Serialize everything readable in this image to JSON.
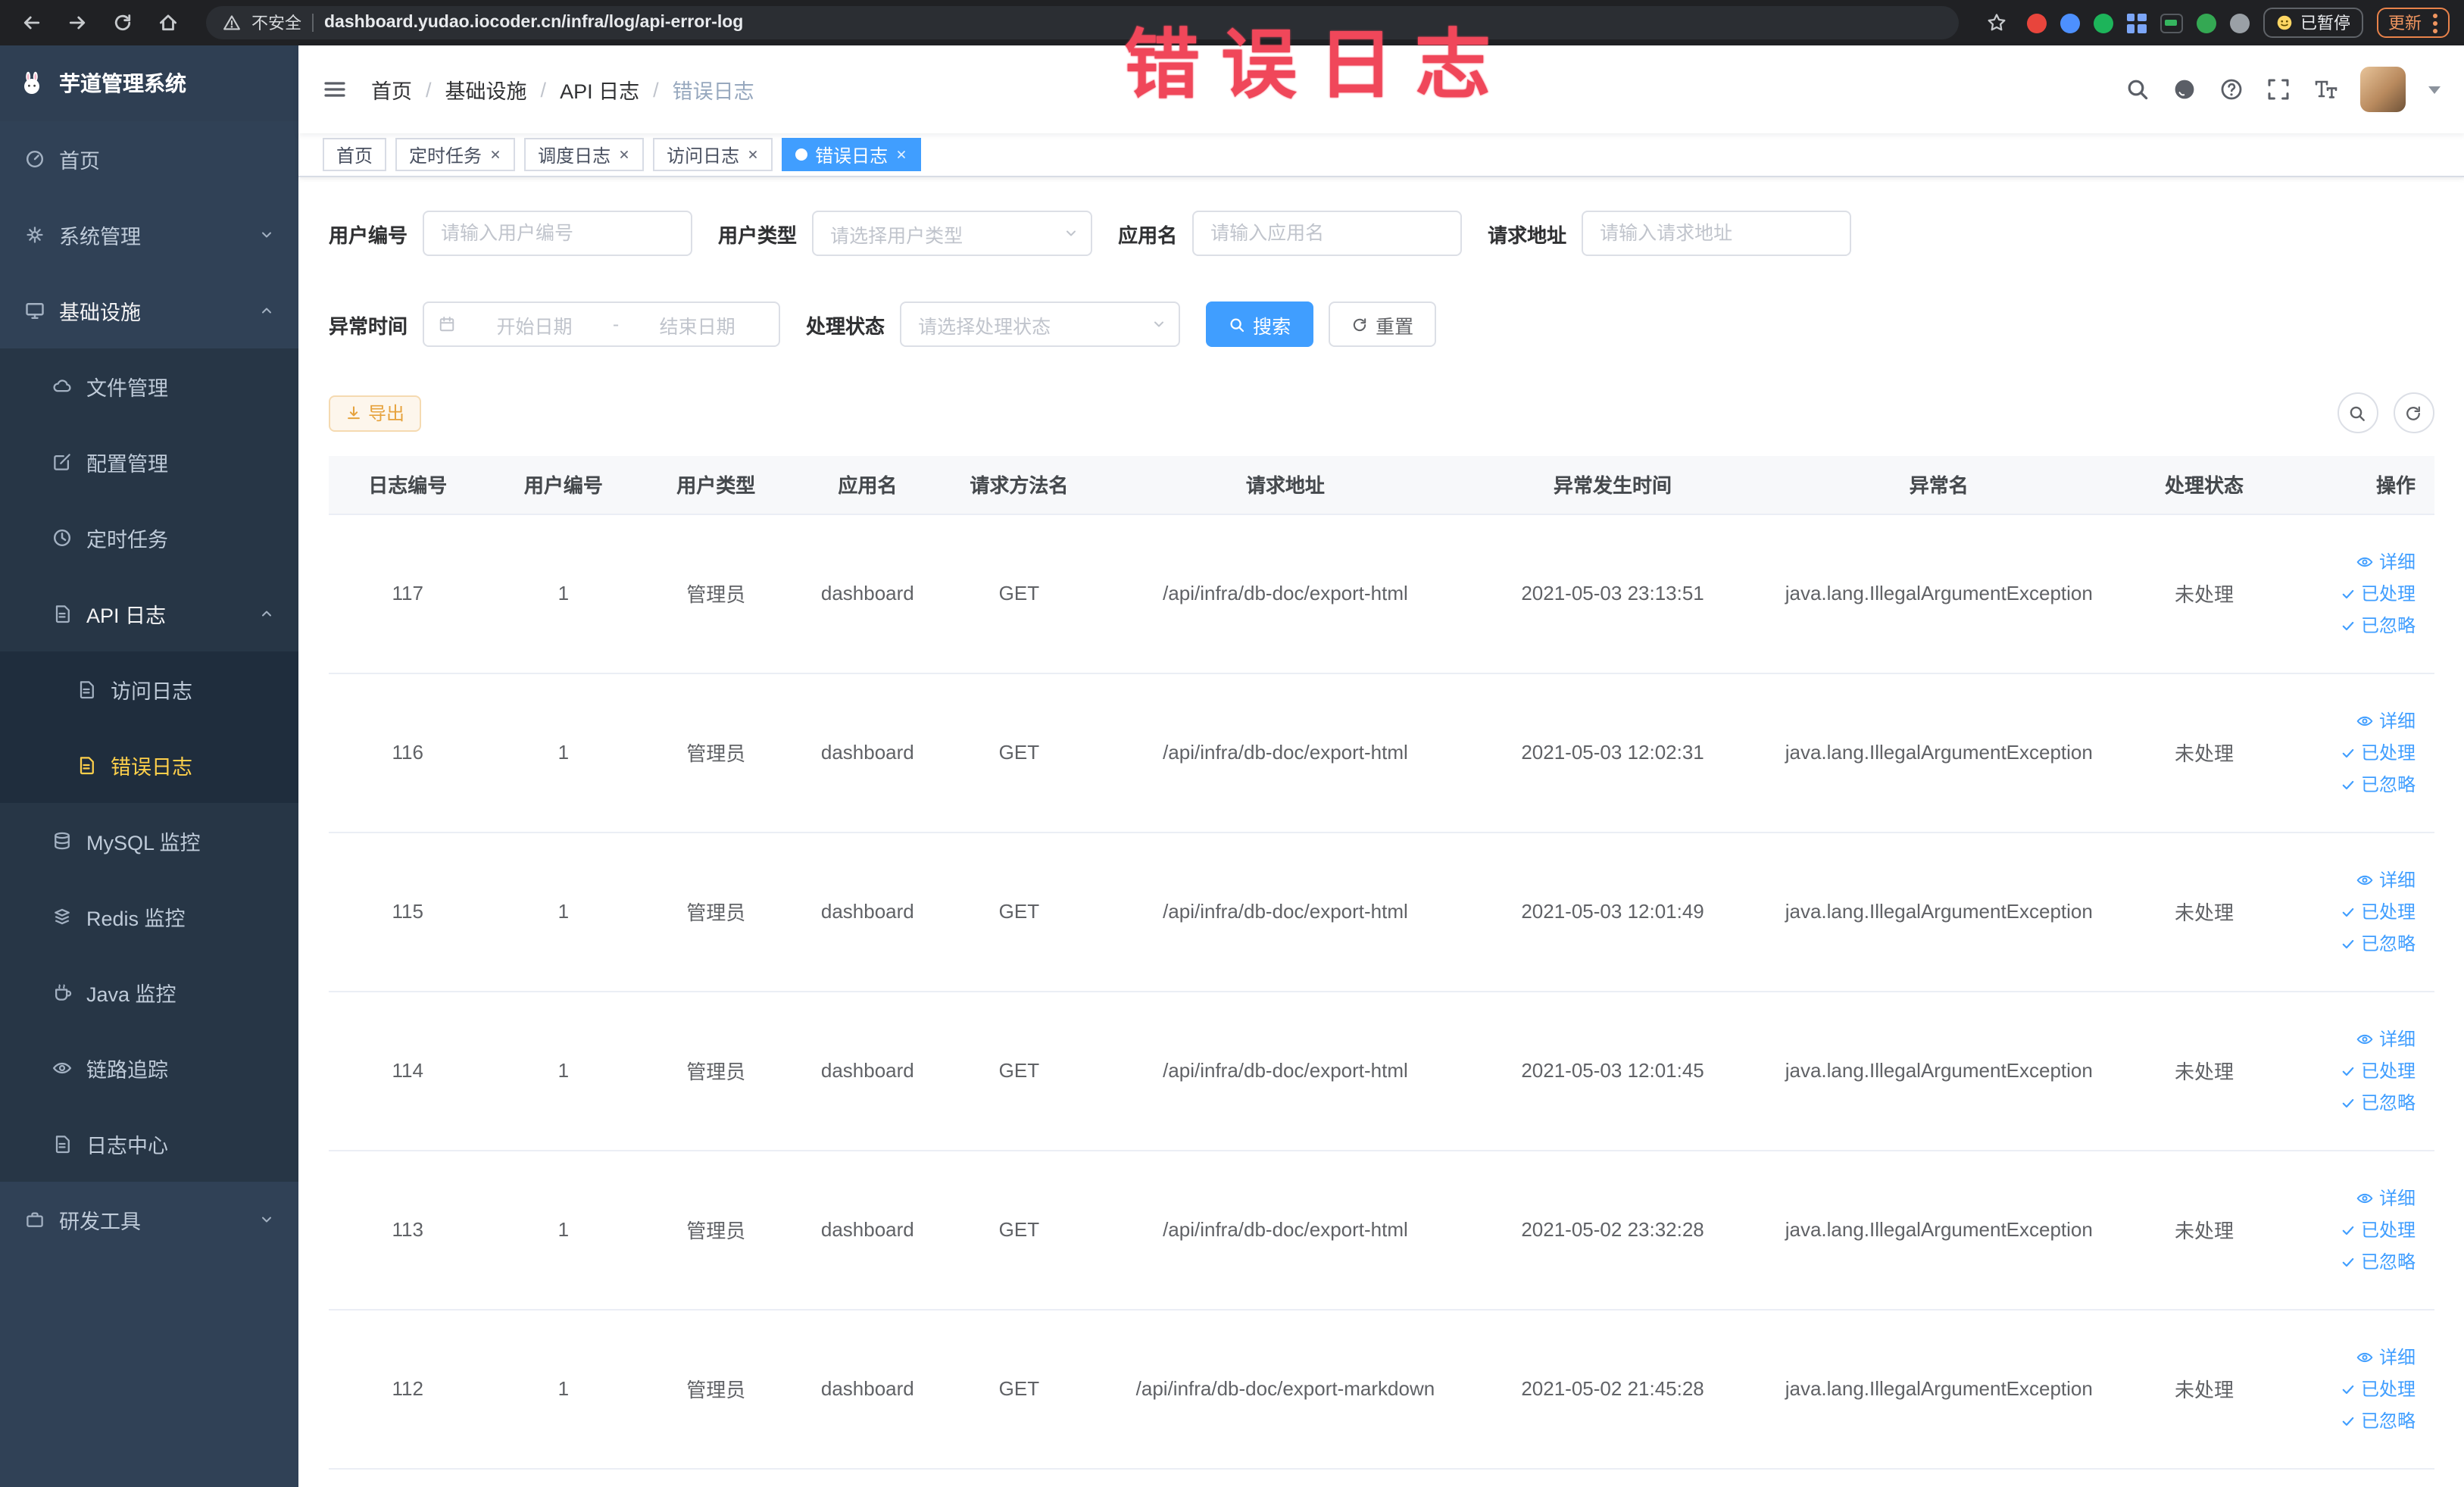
{
  "browser": {
    "security_label": "不安全",
    "url": "dashboard.yudao.iocoder.cn/infra/log/api-error-log",
    "paused_badge": "已暂停",
    "update_label": "更新"
  },
  "annotation": {
    "text": "错误日志",
    "color": "#f0475a"
  },
  "sidebar": {
    "logo_title": "芋道管理系统",
    "items": [
      {
        "label": "首页"
      },
      {
        "label": "系统管理"
      },
      {
        "label": "基础设施"
      },
      {
        "label": "文件管理"
      },
      {
        "label": "配置管理"
      },
      {
        "label": "定时任务"
      },
      {
        "label": "API 日志"
      },
      {
        "label": "访问日志"
      },
      {
        "label": "错误日志"
      },
      {
        "label": "MySQL 监控"
      },
      {
        "label": "Redis 监控"
      },
      {
        "label": "Java 监控"
      },
      {
        "label": "链路追踪"
      },
      {
        "label": "日志中心"
      },
      {
        "label": "研发工具"
      }
    ]
  },
  "header": {
    "breadcrumb": {
      "items": [
        "首页",
        "基础设施",
        "API 日志",
        "错误日志"
      ],
      "separator": "/"
    }
  },
  "tabs": [
    {
      "label": "首页",
      "closable": false,
      "active": false
    },
    {
      "label": "定时任务",
      "closable": true,
      "active": false
    },
    {
      "label": "调度日志",
      "closable": true,
      "active": false
    },
    {
      "label": "访问日志",
      "closable": true,
      "active": false
    },
    {
      "label": "错误日志",
      "closable": true,
      "active": true
    }
  ],
  "filters": {
    "user_id_label": "用户编号",
    "user_id_placeholder": "请输入用户编号",
    "user_type_label": "用户类型",
    "user_type_placeholder": "请选择用户类型",
    "app_name_label": "应用名",
    "app_name_placeholder": "请输入应用名",
    "request_url_label": "请求地址",
    "request_url_placeholder": "请输入请求地址",
    "time_label": "异常时间",
    "time_start_placeholder": "开始日期",
    "time_separator": "-",
    "time_end_placeholder": "结束日期",
    "status_label": "处理状态",
    "status_placeholder": "请选择处理状态",
    "search_button": "搜索",
    "reset_button": "重置"
  },
  "toolbar": {
    "export_button": "导出"
  },
  "table": {
    "columns": [
      "日志编号",
      "用户编号",
      "用户类型",
      "应用名",
      "请求方法名",
      "请求地址",
      "异常发生时间",
      "异常名",
      "处理状态",
      "操作"
    ],
    "actions": {
      "detail": "详细",
      "processed": "已处理",
      "ignored": "已忽略"
    },
    "rows": [
      {
        "id": "117",
        "user_id": "1",
        "user_type": "管理员",
        "app": "dashboard",
        "method": "GET",
        "url": "/api/infra/db-doc/export-html",
        "time": "2021-05-03 23:13:51",
        "exception": "java.lang.IllegalArgumentException",
        "status": "未处理"
      },
      {
        "id": "116",
        "user_id": "1",
        "user_type": "管理员",
        "app": "dashboard",
        "method": "GET",
        "url": "/api/infra/db-doc/export-html",
        "time": "2021-05-03 12:02:31",
        "exception": "java.lang.IllegalArgumentException",
        "status": "未处理"
      },
      {
        "id": "115",
        "user_id": "1",
        "user_type": "管理员",
        "app": "dashboard",
        "method": "GET",
        "url": "/api/infra/db-doc/export-html",
        "time": "2021-05-03 12:01:49",
        "exception": "java.lang.IllegalArgumentException",
        "status": "未处理"
      },
      {
        "id": "114",
        "user_id": "1",
        "user_type": "管理员",
        "app": "dashboard",
        "method": "GET",
        "url": "/api/infra/db-doc/export-html",
        "time": "2021-05-03 12:01:45",
        "exception": "java.lang.IllegalArgumentException",
        "status": "未处理"
      },
      {
        "id": "113",
        "user_id": "1",
        "user_type": "管理员",
        "app": "dashboard",
        "method": "GET",
        "url": "/api/infra/db-doc/export-html",
        "time": "2021-05-02 23:32:28",
        "exception": "java.lang.IllegalArgumentException",
        "status": "未处理"
      },
      {
        "id": "112",
        "user_id": "1",
        "user_type": "管理员",
        "app": "dashboard",
        "method": "GET",
        "url": "/api/infra/db-doc/export-markdown",
        "time": "2021-05-02 21:45:28",
        "exception": "java.lang.IllegalArgumentException",
        "status": "未处理"
      }
    ]
  },
  "icons": {
    "header": [
      "search-icon",
      "github-icon",
      "help-icon",
      "fullscreen-icon",
      "font-size-icon",
      "caret-down-icon"
    ],
    "actions": [
      "eye-icon",
      "check-icon"
    ],
    "toolbar": [
      "download-icon",
      "search-icon",
      "refresh-icon"
    ]
  },
  "colors": {
    "accent": "#409eff",
    "sidebar_bg": "#304156",
    "sidebar_active": "#ffd04b",
    "warning": "#e6a23c",
    "annotation": "#f0475a"
  }
}
